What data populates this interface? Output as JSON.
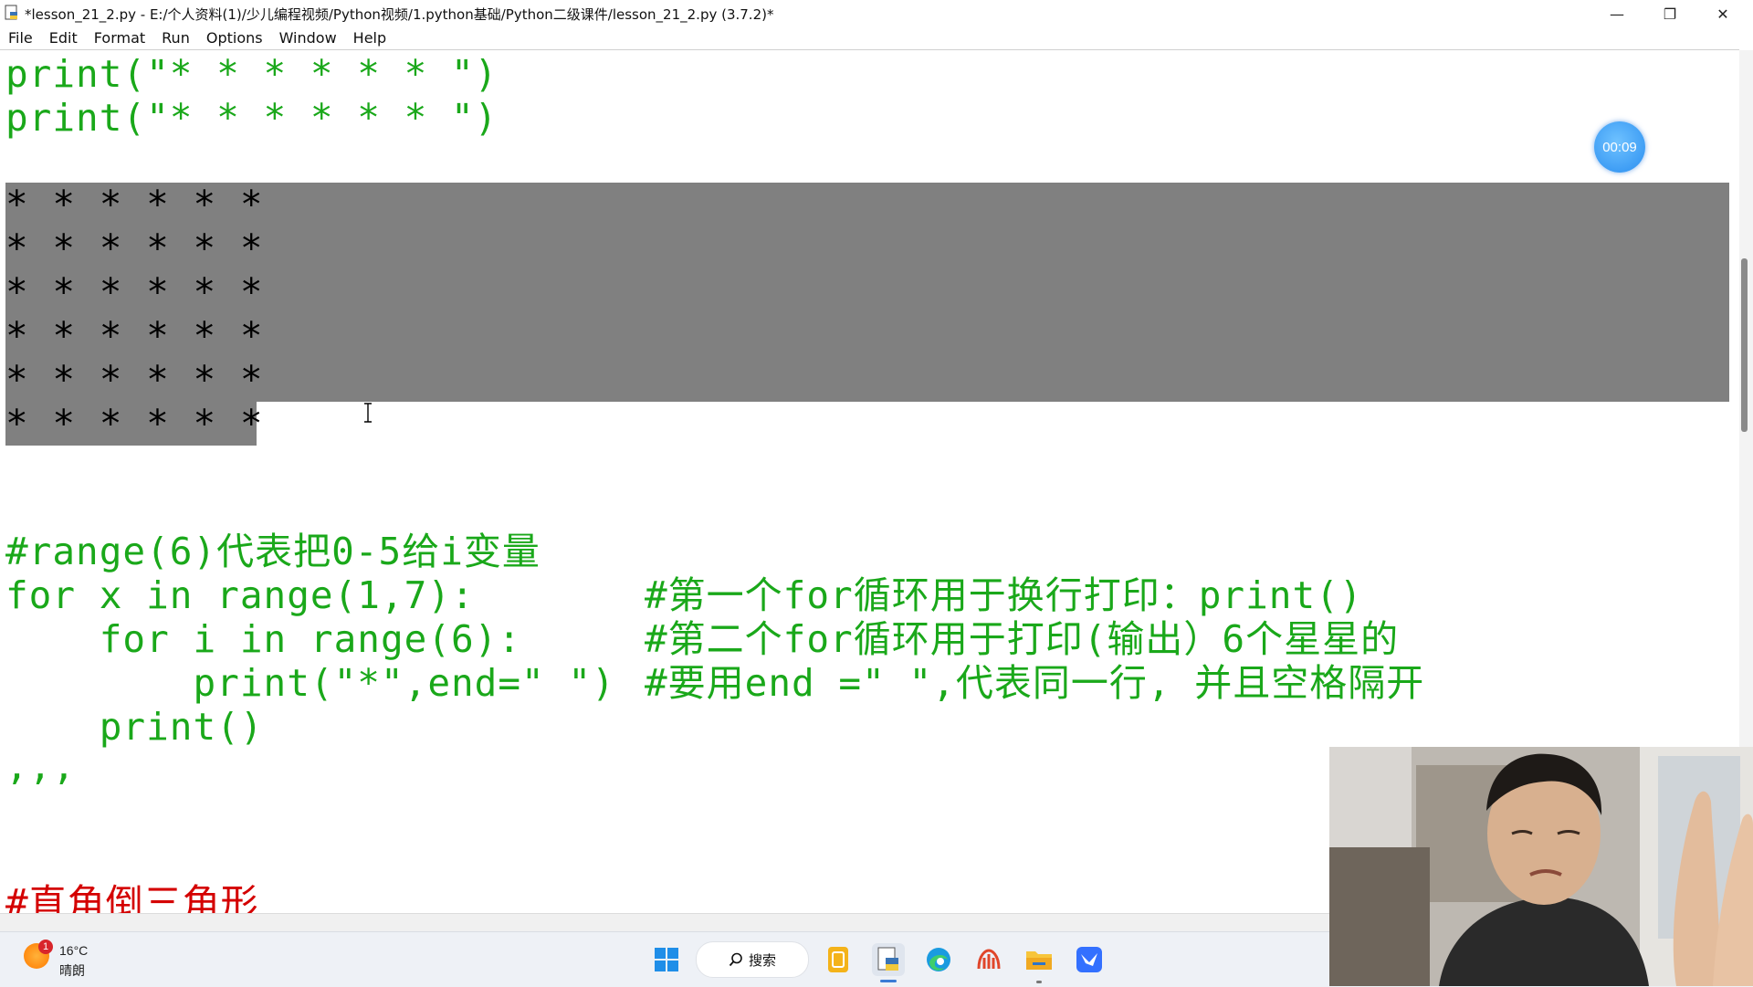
{
  "window": {
    "title": "*lesson_21_2.py - E:/个人资料(1)/少儿编程视频/Python视频/1.python基础/Python二级课件/lesson_21_2.py (3.7.2)*",
    "minimize_glyph": "—",
    "restore_glyph": "❐",
    "close_glyph": "✕"
  },
  "menu": [
    "File",
    "Edit",
    "Format",
    "Run",
    "Options",
    "Window",
    "Help"
  ],
  "timer": "00:09",
  "code": {
    "line1": "print(\"* * * * * * \")",
    "line2": "print(\"* * * * * * \")",
    "star_rows": [
      "* * * * * *",
      "* * * * * *",
      "* * * * * *",
      "* * * * * *",
      "* * * * * *",
      "* * * * * *"
    ],
    "comment_range": "#range(6)代表把0-5给i变量",
    "for_outer": "for x in range(1,7):",
    "for_outer_comment": "#第一个for循环用于换行打印：print()",
    "for_inner": "    for i in range(6):",
    "for_inner_comment": "#第二个for循环用于打印(输出）6个星星的",
    "print_star": "        print(\"*\",end=\" \")",
    "print_star_comment": "#要用end =\" \",代表同一行, 并且空格隔开",
    "print_empty": "    print()",
    "triple_quote": ",,,",
    "heading_partial": "#直角倒三角形"
  },
  "taskbar": {
    "weather_badge": "1",
    "weather_temp": "16°C",
    "weather_desc": "晴朗",
    "search_label": "搜索",
    "icons": [
      "windows-start-icon",
      "search-icon",
      "notes-app-icon",
      "python-idle-icon",
      "edge-browser-icon",
      "huawei-app-icon",
      "file-explorer-icon",
      "feishu-app-icon"
    ]
  },
  "colors": {
    "code_green": "#1aa81a",
    "heading_red": "#d40000",
    "selection_gray": "#808080",
    "timer_blue": "#2a8ef0"
  }
}
